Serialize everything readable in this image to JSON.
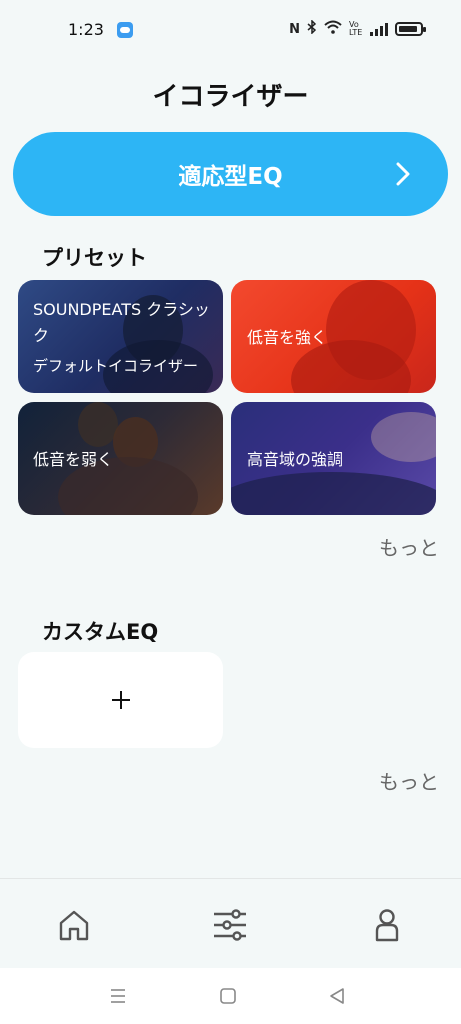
{
  "status_bar": {
    "time": "1:23",
    "network_label": "Vo LTE"
  },
  "page": {
    "title": "イコライザー"
  },
  "adaptive_eq": {
    "label": "適応型EQ",
    "color": "#2db5f5"
  },
  "presets": {
    "title": "プリセット",
    "items": [
      {
        "title": "SOUNDPEATS クラシック",
        "subtitle": "デフォルトイコライザー"
      },
      {
        "title": "低音を強く"
      },
      {
        "title": "低音を弱く"
      },
      {
        "title": "高音域の強調"
      }
    ],
    "more_label": "もっと"
  },
  "custom_eq": {
    "title": "カスタムEQ",
    "add_label": "+",
    "more_label": "もっと"
  },
  "bottom_nav": {
    "items": [
      {
        "icon": "home-icon"
      },
      {
        "icon": "equalizer-icon"
      },
      {
        "icon": "profile-icon"
      }
    ]
  },
  "system_nav": {
    "items": [
      {
        "icon": "menu-icon"
      },
      {
        "icon": "home-square-icon"
      },
      {
        "icon": "back-icon"
      }
    ]
  }
}
